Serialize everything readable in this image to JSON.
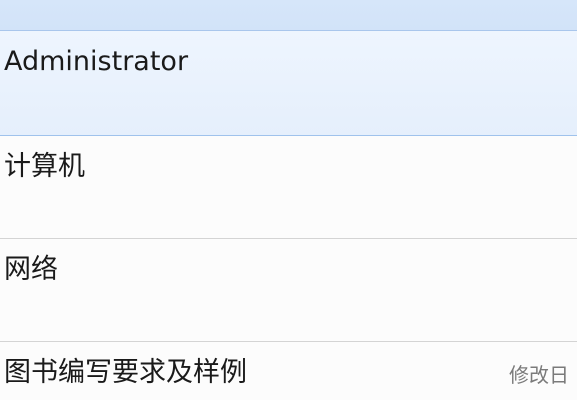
{
  "list": {
    "items": [
      {
        "label": "Administrator",
        "selected": true
      },
      {
        "label": "计算机",
        "selected": false
      },
      {
        "label": "网络",
        "selected": false
      },
      {
        "label": "图书编写要求及样例",
        "selected": false,
        "meta": "修改日"
      }
    ]
  },
  "colors": {
    "selection": "#e5effc",
    "selection_border": "#9fc2ec",
    "divider": "#d4d4d4",
    "top_strip": "#d2e3f8"
  }
}
